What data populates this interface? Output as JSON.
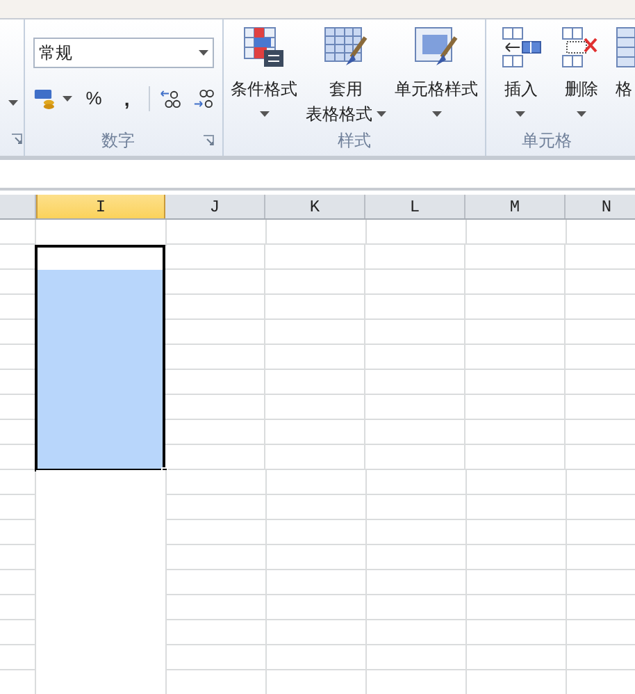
{
  "left_group": {
    "has_dropdown": true
  },
  "number_group": {
    "format": "常规",
    "percent": "%",
    "comma": ",",
    "label": "数字"
  },
  "styles_group": {
    "label": "样式",
    "buttons": [
      {
        "kind": "conditional",
        "lines": [
          "条件格式"
        ]
      },
      {
        "kind": "table",
        "lines": [
          "套用",
          "表格格式"
        ]
      },
      {
        "kind": "cellstyle",
        "lines": [
          "单元格样式"
        ]
      }
    ]
  },
  "cells_group": {
    "label": "单元格",
    "buttons": [
      {
        "kind": "insert",
        "label": "插入"
      },
      {
        "kind": "delete",
        "label": "删除"
      },
      {
        "kind": "format",
        "label": "格"
      }
    ]
  },
  "columns": [
    {
      "label": "I",
      "selected": true
    },
    {
      "label": "J",
      "selected": false
    },
    {
      "label": "K",
      "selected": false
    },
    {
      "label": "L",
      "selected": false
    },
    {
      "label": "M",
      "selected": false
    },
    {
      "label": "N",
      "selected": false
    }
  ],
  "column_i_cells": [
    {
      "selected": false,
      "active": false
    },
    {
      "selected": true,
      "active": true
    },
    {
      "selected": true,
      "active": false
    },
    {
      "selected": true,
      "active": false
    },
    {
      "selected": true,
      "active": false
    },
    {
      "selected": true,
      "active": false
    },
    {
      "selected": true,
      "active": false
    },
    {
      "selected": true,
      "active": false
    },
    {
      "selected": true,
      "active": false
    },
    {
      "selected": true,
      "active": false
    },
    {
      "selected": false,
      "active": false
    },
    {
      "selected": false,
      "active": false
    },
    {
      "selected": false,
      "active": false
    },
    {
      "selected": false,
      "active": false
    },
    {
      "selected": false,
      "active": false
    },
    {
      "selected": false,
      "active": false
    },
    {
      "selected": false,
      "active": false
    },
    {
      "selected": false,
      "active": false
    },
    {
      "selected": false,
      "active": false
    }
  ]
}
